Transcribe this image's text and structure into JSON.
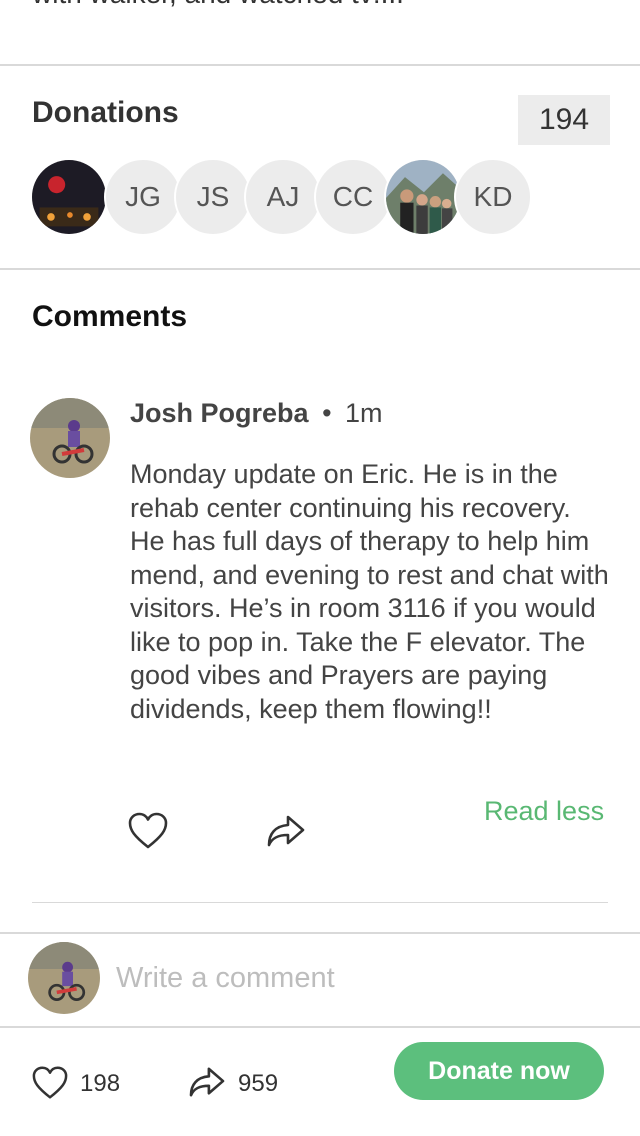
{
  "story": {
    "truncated_text": "with walker, and watched tv!..."
  },
  "donations": {
    "title": "Donations",
    "count": "194",
    "donors": [
      {
        "type": "photo",
        "icon": "donor-photo-dark"
      },
      {
        "type": "initials",
        "initials": "JG"
      },
      {
        "type": "initials",
        "initials": "JS"
      },
      {
        "type": "initials",
        "initials": "AJ"
      },
      {
        "type": "initials",
        "initials": "CC"
      },
      {
        "type": "photo",
        "icon": "donor-photo-group"
      },
      {
        "type": "initials",
        "initials": "KD"
      }
    ]
  },
  "comments": {
    "title": "Comments",
    "items": [
      {
        "author": "Josh Pogreba",
        "separator": "•",
        "time": "1m",
        "text": "Monday update on Eric. He is in the rehab center continuing his recovery. He has full days of therapy to help him mend, and evening to rest and chat with visitors. He’s in room 3116 if you would like to pop in. Take the F elevator. The good vibes and Prayers are paying dividends, keep them flowing!!",
        "toggle_label": "Read less"
      }
    ],
    "composer_placeholder": "Write a comment"
  },
  "footer": {
    "likes": "198",
    "shares": "959",
    "donate_label": "Donate now"
  },
  "colors": {
    "accent_green": "#5cbf7d",
    "link_green": "#59b873",
    "badge_bg": "#ececec"
  }
}
